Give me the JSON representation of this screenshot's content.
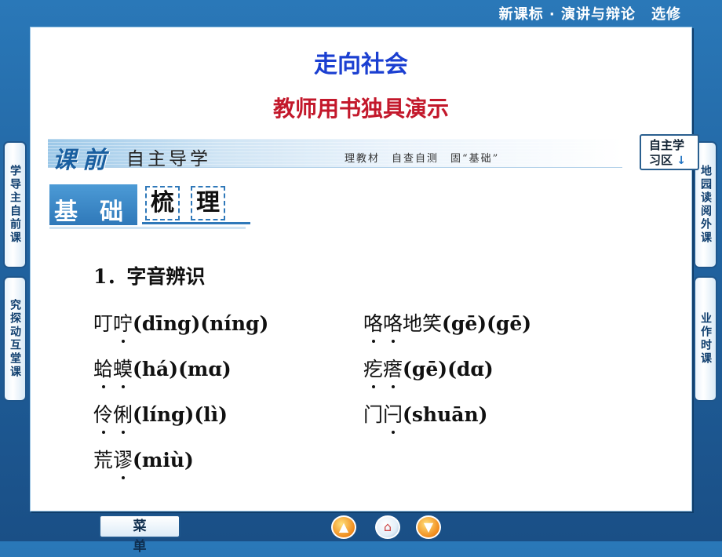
{
  "header": {
    "course": "新课标 · 演讲与辩论",
    "edition": "选修"
  },
  "slide": {
    "title": "走向社会",
    "subtitle": "教师用书独具演示"
  },
  "banner": {
    "big": "课前",
    "sub": "自主导学",
    "tag": "理教材　自查自测　固“基础”",
    "corner_line1": "自主学",
    "corner_line2": "习区",
    "corner_arrow": "↓"
  },
  "basis": {
    "c1": "基",
    "c2": "础",
    "c3": "梳",
    "c4": "理"
  },
  "section": {
    "title": "1．字音辨识"
  },
  "items": [
    {
      "chars": "叮咛",
      "pinyin": "(dīng)(níng)"
    },
    {
      "chars": "咯咯地笑",
      "pinyin": "(gē)(gē)"
    },
    {
      "chars": "蛤蟆",
      "pinyin": "(há)(mɑ)"
    },
    {
      "chars": "疙瘩",
      "pinyin": "(gē)(dɑ)"
    },
    {
      "chars": "伶俐",
      "pinyin": "(líng)(lì)"
    },
    {
      "chars": "门闩",
      "pinyin": "(shuān)"
    },
    {
      "chars": "荒谬",
      "pinyin": "(miù)"
    }
  ],
  "side_tabs": {
    "left_top": "学导主自前课",
    "left_bottom": "究探动互堂课",
    "right_top": "地园读阅外课",
    "right_bottom": "业作时课"
  },
  "bottom": {
    "menu": "菜单"
  },
  "colors": {
    "title_blue": "#1b3fd1",
    "subtitle_red": "#c3182b",
    "frame_blue": "#2a78b8"
  }
}
